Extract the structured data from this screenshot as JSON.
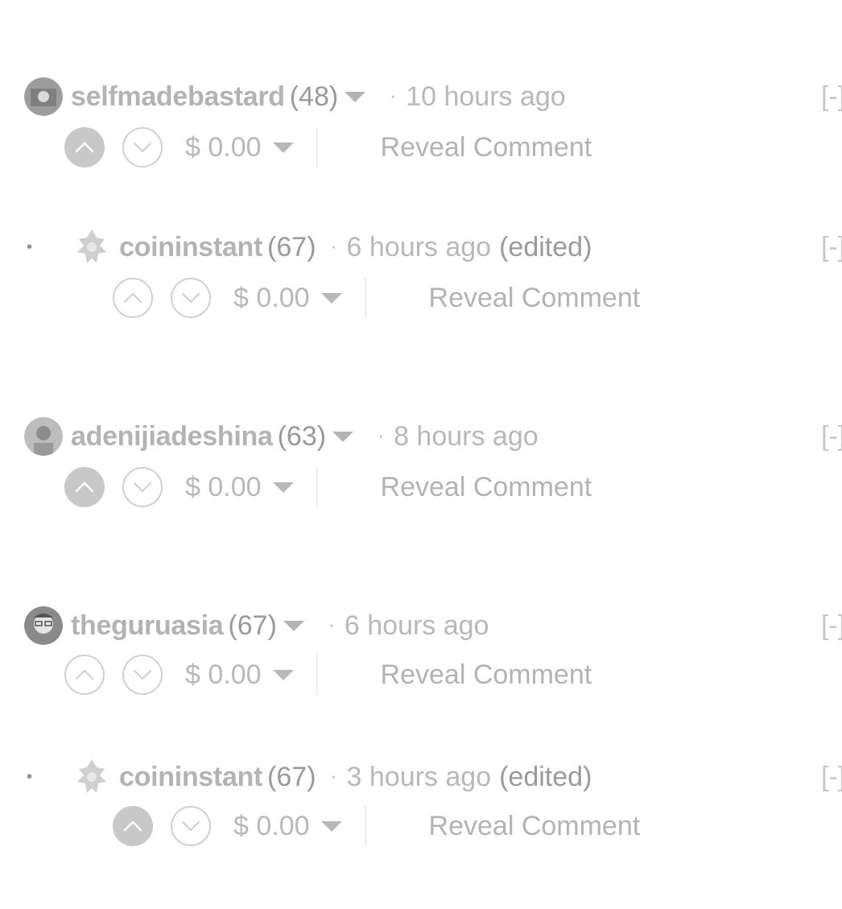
{
  "comments": [
    {
      "author": "selfmadebastard",
      "reputation": "(48)",
      "separator": "·",
      "time": "10 hours ago",
      "edited": "",
      "payout": "$ 0.00",
      "reveal_label": "Reveal Comment",
      "collapse_label": "[-]",
      "reply_bullet": "",
      "upvoted": true,
      "avatar_color": "#9d9d9d"
    },
    {
      "author": "coininstant",
      "reputation": "(67)",
      "separator": "·",
      "time": "6 hours ago",
      "edited": "(edited)",
      "payout": "$ 0.00",
      "reveal_label": "Reveal Comment",
      "collapse_label": "[-]",
      "reply_bullet": "•",
      "upvoted": false,
      "avatar_color": "#cfcfcf"
    },
    {
      "author": "adenijiadeshina",
      "reputation": "(63)",
      "separator": "·",
      "time": "8 hours ago",
      "edited": "",
      "payout": "$ 0.00",
      "reveal_label": "Reveal Comment",
      "collapse_label": "[-]",
      "reply_bullet": "",
      "upvoted": true,
      "avatar_color": "#bdbdbd"
    },
    {
      "author": "theguruasia",
      "reputation": "(67)",
      "separator": "·",
      "time": "6 hours ago",
      "edited": "",
      "payout": "$ 0.00",
      "reveal_label": "Reveal Comment",
      "collapse_label": "[-]",
      "reply_bullet": "",
      "upvoted": false,
      "avatar_color": "#8a8a8a"
    },
    {
      "author": "coininstant",
      "reputation": "(67)",
      "separator": "·",
      "time": "3 hours ago",
      "edited": "(edited)",
      "payout": "$ 0.00",
      "reveal_label": "Reveal Comment",
      "collapse_label": "[-]",
      "reply_bullet": "•",
      "upvoted": true,
      "avatar_color": "#cfcfcf"
    }
  ]
}
